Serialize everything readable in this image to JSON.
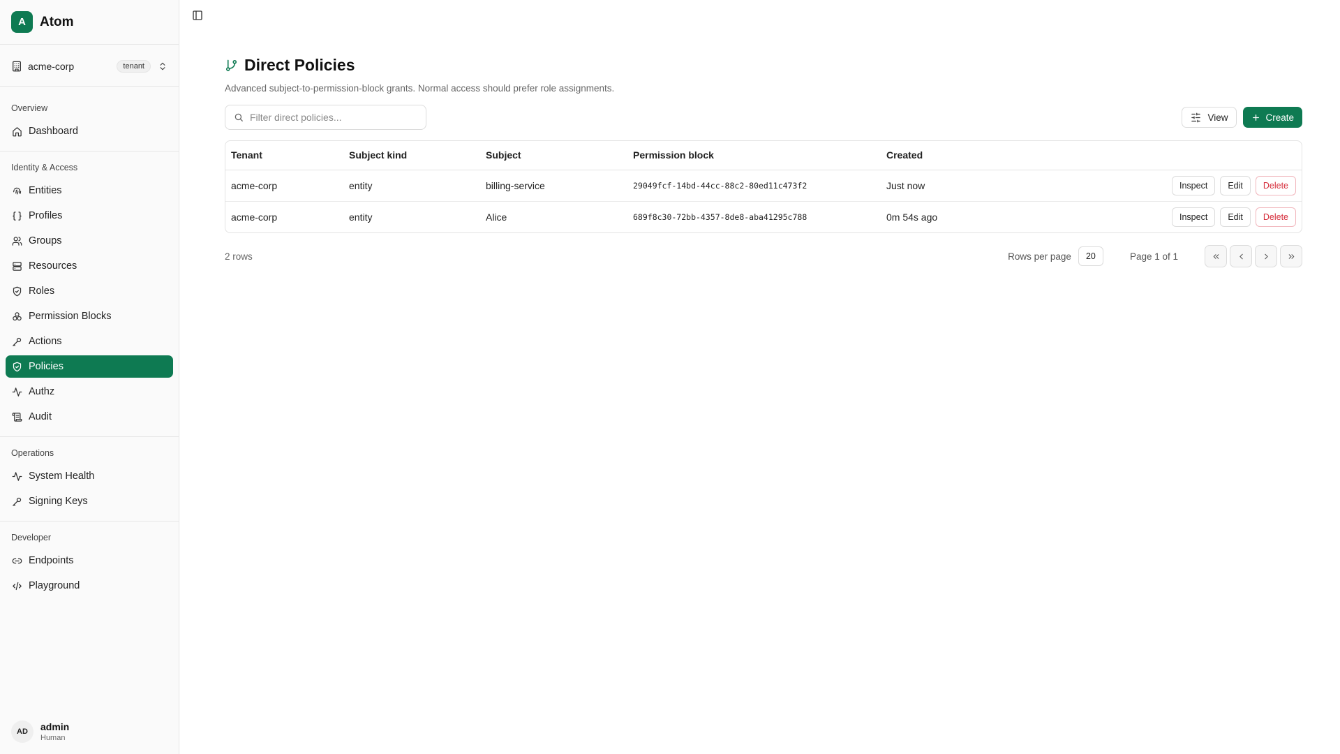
{
  "brand": {
    "logo_letter": "A",
    "name": "Atom",
    "accent": "#0e7a52"
  },
  "tenant": {
    "name": "acme-corp",
    "badge": "tenant"
  },
  "sidebar": {
    "sections": [
      {
        "heading": "Overview",
        "items": [
          {
            "label": "Dashboard",
            "icon": "home-icon"
          }
        ]
      },
      {
        "heading": "Identity & Access",
        "items": [
          {
            "label": "Entities",
            "icon": "fingerprint-icon"
          },
          {
            "label": "Profiles",
            "icon": "braces-icon"
          },
          {
            "label": "Groups",
            "icon": "users-icon"
          },
          {
            "label": "Resources",
            "icon": "server-icon"
          },
          {
            "label": "Roles",
            "icon": "shield-icon"
          },
          {
            "label": "Permission Blocks",
            "icon": "blocks-icon"
          },
          {
            "label": "Actions",
            "icon": "wrench-icon"
          },
          {
            "label": "Policies",
            "icon": "shield-check-icon",
            "active": true
          },
          {
            "label": "Authz",
            "icon": "activity-icon"
          },
          {
            "label": "Audit",
            "icon": "scroll-icon"
          }
        ]
      },
      {
        "heading": "Operations",
        "items": [
          {
            "label": "System Health",
            "icon": "activity-icon"
          },
          {
            "label": "Signing Keys",
            "icon": "key-icon"
          }
        ]
      },
      {
        "heading": "Developer",
        "items": [
          {
            "label": "Endpoints",
            "icon": "link-icon"
          },
          {
            "label": "Playground",
            "icon": "code-icon"
          }
        ]
      }
    ]
  },
  "user": {
    "initials": "AD",
    "name": "admin",
    "role": "Human"
  },
  "page": {
    "title": "Direct Policies",
    "subtitle": "Advanced subject-to-permission-block grants. Normal access should prefer role assignments.",
    "title_icon": "git-branch-icon"
  },
  "toolbar": {
    "search_placeholder": "Filter direct policies...",
    "search_value": "",
    "view_label": "View",
    "create_label": "Create"
  },
  "table": {
    "columns": [
      "Tenant",
      "Subject kind",
      "Subject",
      "Permission block",
      "Created"
    ],
    "rows": [
      {
        "tenant": "acme-corp",
        "subject_kind": "entity",
        "subject": "billing-service",
        "permission_block": "29049fcf-14bd-44cc-88c2-80ed11c473f2",
        "created": "Just now"
      },
      {
        "tenant": "acme-corp",
        "subject_kind": "entity",
        "subject": "Alice",
        "permission_block": "689f8c30-72bb-4357-8de8-aba41295c788",
        "created": "0m 54s ago"
      }
    ],
    "row_actions": {
      "inspect": "Inspect",
      "edit": "Edit",
      "delete": "Delete"
    }
  },
  "footer": {
    "row_count": "2 rows",
    "rows_per_page_label": "Rows per page",
    "rows_per_page": "20",
    "page_info": "Page 1 of 1"
  }
}
